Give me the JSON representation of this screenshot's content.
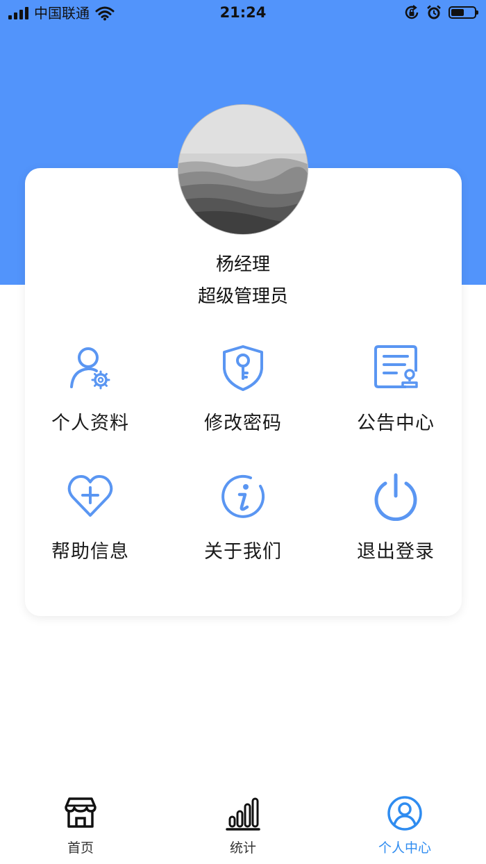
{
  "status_bar": {
    "carrier": "中国联通",
    "time": "21:24",
    "battery_level": 0.55
  },
  "profile": {
    "name": "杨经理",
    "role": "超级管理员",
    "avatar": "misty-mountains-photo"
  },
  "menu": [
    {
      "label": "个人资料",
      "icon": "user-settings-icon"
    },
    {
      "label": "修改密码",
      "icon": "shield-key-icon"
    },
    {
      "label": "公告中心",
      "icon": "notice-board-icon"
    },
    {
      "label": "帮助信息",
      "icon": "heart-plus-icon"
    },
    {
      "label": "关于我们",
      "icon": "info-icon"
    },
    {
      "label": "退出登录",
      "icon": "power-icon"
    }
  ],
  "tabs": [
    {
      "label": "首页",
      "icon": "store-icon",
      "active": false
    },
    {
      "label": "统计",
      "icon": "bar-chart-icon",
      "active": false
    },
    {
      "label": "个人中心",
      "icon": "person-circle-icon",
      "active": true
    }
  ],
  "colors": {
    "header_blue": "#5294fb",
    "icon_blue": "#5a96f2",
    "active_tab": "#2f8cf0"
  }
}
